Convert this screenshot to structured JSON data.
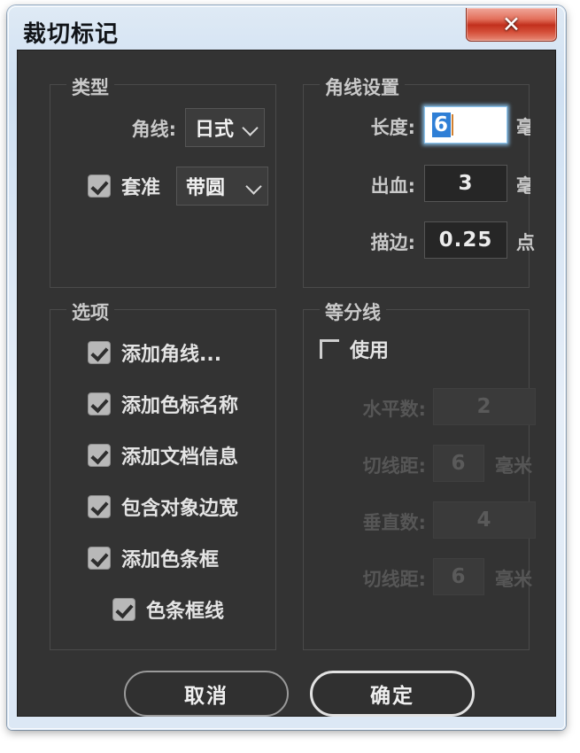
{
  "window": {
    "title": "裁切标记",
    "close_label": "✕",
    "frame_color": "#cfe0f2",
    "client_bg": "#333333",
    "close_color": "#c2301d"
  },
  "type_group": {
    "title": "类型",
    "corner_line_label": "角线:",
    "corner_line_value": "日式",
    "corner_line_options": [
      "日式"
    ],
    "registration_checkbox": {
      "label": "套准",
      "checked": true
    },
    "registration_value": "带圆",
    "registration_options": [
      "带圆"
    ]
  },
  "corner_settings_group": {
    "title": "角线设置",
    "rows": [
      {
        "label": "长度:",
        "value": "6",
        "unit": "毫米",
        "focused": true,
        "disabled": false
      },
      {
        "label": "出血:",
        "value": "3",
        "unit": "毫米",
        "focused": false,
        "disabled": false
      },
      {
        "label": "描边:",
        "value": "0.25",
        "unit": "点",
        "focused": false,
        "disabled": false
      }
    ]
  },
  "options_group": {
    "title": "选项",
    "items": [
      {
        "label": "添加角线...",
        "checked": true,
        "indented": false
      },
      {
        "label": "添加色标名称",
        "checked": true,
        "indented": false
      },
      {
        "label": "添加文档信息",
        "checked": true,
        "indented": false
      },
      {
        "label": "包含对象边宽",
        "checked": true,
        "indented": false
      },
      {
        "label": "添加色条框",
        "checked": true,
        "indented": false
      },
      {
        "label": "色条框线",
        "checked": true,
        "indented": true
      }
    ]
  },
  "divider_group": {
    "title": "等分线",
    "use_checkbox": {
      "label": "使用",
      "checked": false
    },
    "rows": [
      {
        "label": "水平数:",
        "value": "2",
        "unit": "",
        "disabled": true
      },
      {
        "label": "切线距:",
        "value": "6",
        "unit": "毫米",
        "disabled": true
      },
      {
        "label": "垂直数:",
        "value": "4",
        "unit": "",
        "disabled": true
      },
      {
        "label": "切线距:",
        "value": "6",
        "unit": "毫米",
        "disabled": true
      }
    ]
  },
  "footer": {
    "cancel_label": "取消",
    "ok_label": "确定"
  }
}
